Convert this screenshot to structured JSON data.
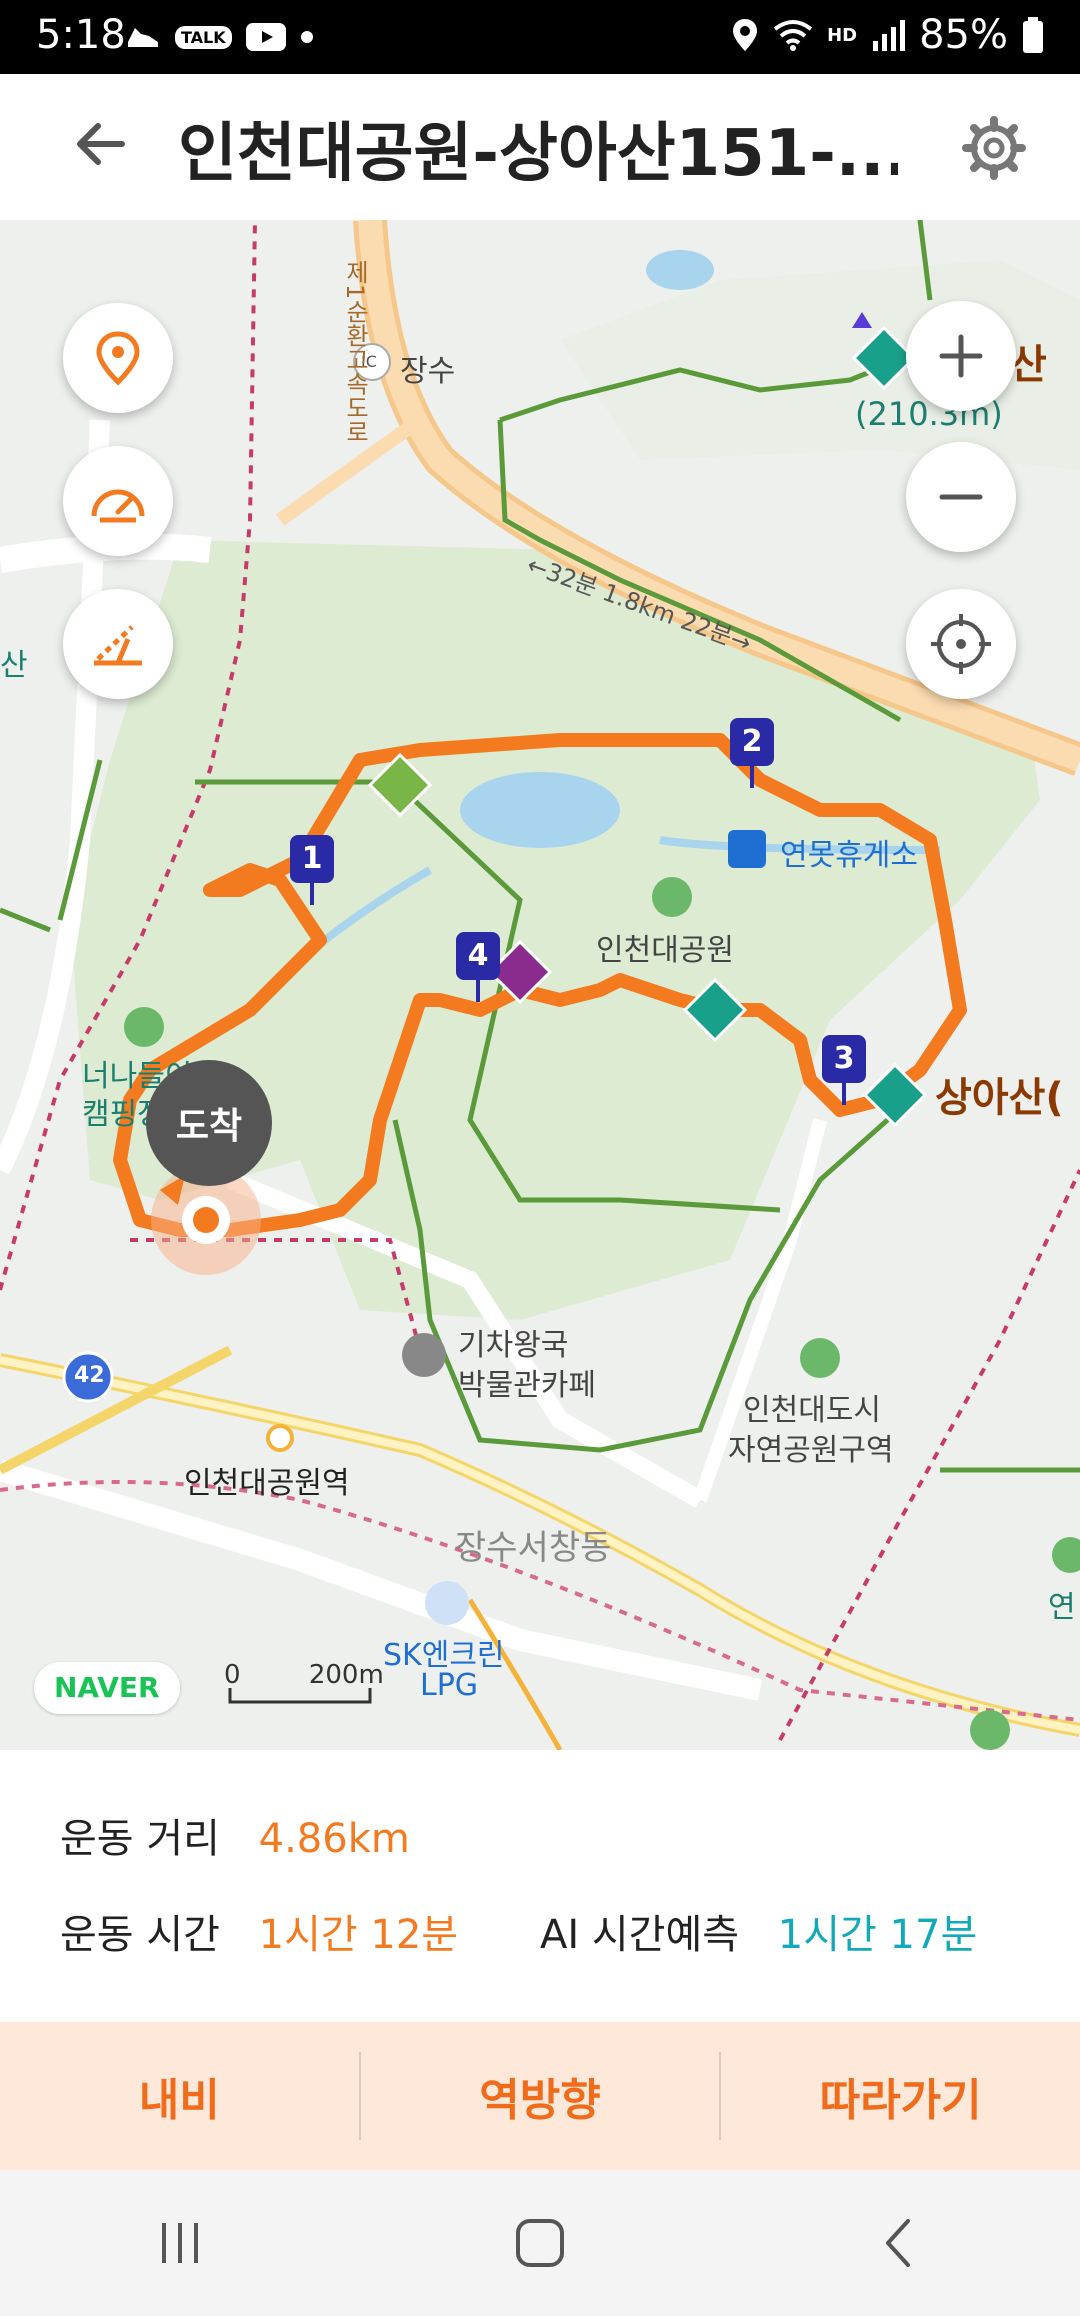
{
  "status_bar": {
    "time": "5:18",
    "talk_badge": "TALK",
    "hd_badge": "HD",
    "battery": "85%"
  },
  "header": {
    "title": "인천대공원-상아산151-...",
    "back_icon": "back-arrow-icon",
    "settings_icon": "gear-icon"
  },
  "map": {
    "labels": {
      "jangsu": "장수",
      "ic": "IC",
      "road_distance": "←32분 1.8km 22분→",
      "road_name_vertical": "제1순환고속도로",
      "peak_elevation": "(210.3m)",
      "peak_name_partial": "산",
      "rest_area": "연못휴게소",
      "park": "인천대공원",
      "sangasan": "상아산(",
      "camping": "너나들이 캠핑장",
      "train_cafe_1": "기차왕국",
      "train_cafe_2": "박물관카페",
      "city_park_1": "인천대도시",
      "city_park_2": "자연공원구역",
      "station": "인천대공원역",
      "district": "장수서창동",
      "gas_1": "SK엔크린",
      "gas_2": "LPG",
      "route_42": "42",
      "edge_right": "연",
      "edge_left": "산"
    },
    "waypoints": [
      "1",
      "2",
      "3",
      "4"
    ],
    "arrive_label": "도착",
    "brand": "NAVER",
    "scale_zero": "0",
    "scale_label": "200m"
  },
  "summary": {
    "distance_label": "운동 거리",
    "distance_value": "4.86km",
    "time_label": "운동 시간",
    "time_value": "1시간 12분",
    "ai_label": "AI 시간예측",
    "ai_value": "1시간 17분"
  },
  "actions": {
    "navi": "내비",
    "reverse": "역방향",
    "follow": "따라가기"
  },
  "colors": {
    "route": "#f47a20",
    "accent_orange": "#f47a20",
    "accent_teal": "#12a9b8",
    "park_green": "#dcebd2",
    "trail_green": "#5a9a3a",
    "pin_navy": "#2a2aa6"
  }
}
